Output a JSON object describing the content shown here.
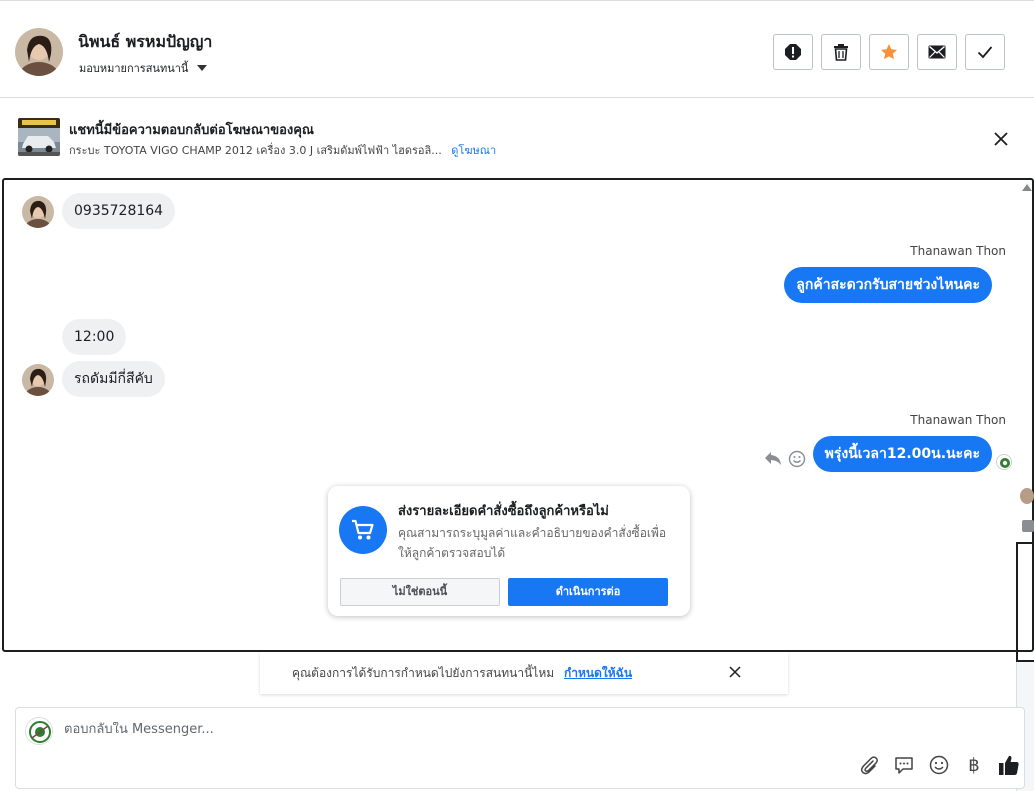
{
  "header": {
    "contact_name": "นิพนธ์ พรหมปัญญา",
    "assign_label": "มอบหมายการสนทนานี้",
    "actions": [
      "spam-icon",
      "trash-icon",
      "star-icon",
      "envelope-icon",
      "check-icon"
    ],
    "star_color": "#f7923b"
  },
  "ad_banner": {
    "title": "แชทนี้มีข้อความตอบกลับต่อโฆษณาของคุณ",
    "subtitle": "กระบะ TOYOTA VIGO CHAMP 2012 เครื่อง 3.0 J เสริมดัมพ์ไฟฟ้า ไฮดรอลิ...",
    "link": "ดูโฆษณา"
  },
  "messages": {
    "m1": "0935728164",
    "sender1": "Thanawan Thon",
    "m2": "ลูกค้าสะดวกรับสายช่วงไหนคะ",
    "m3": "12:00",
    "m4": "รถดัมมีกี่สีคับ",
    "sender2": "Thanawan Thon",
    "m5": "พรุ่งนี้เวลา12.00น.นะคะ"
  },
  "order_prompt": {
    "title": "ส่งรายละเอียดคำสั่งซื้อถึงลูกค้าหรือไม่",
    "description": "คุณสามารถระบุมูลค่าและคำอธิบายของคำสั่งซื้อเพื่อให้ลูกค้าตรวจสอบได้",
    "secondary_button": "ไม่ใช่ตอนนี้",
    "primary_button": "ดำเนินการต่อ"
  },
  "notice": {
    "text": "คุณต้องการได้รับการกำหนดไปยังการสนทนานี้ไหม",
    "link": "กำหนดให้ฉัน"
  },
  "composer": {
    "placeholder": "ตอบกลับใน Messenger...",
    "tools": [
      "paperclip-icon",
      "speech-bubble-icon",
      "emoji-icon",
      "baht-icon",
      "thumbs-up-icon"
    ],
    "baht_symbol": "฿"
  },
  "colors": {
    "accent": "#1877f2",
    "bubble_in": "#eef0f2"
  }
}
